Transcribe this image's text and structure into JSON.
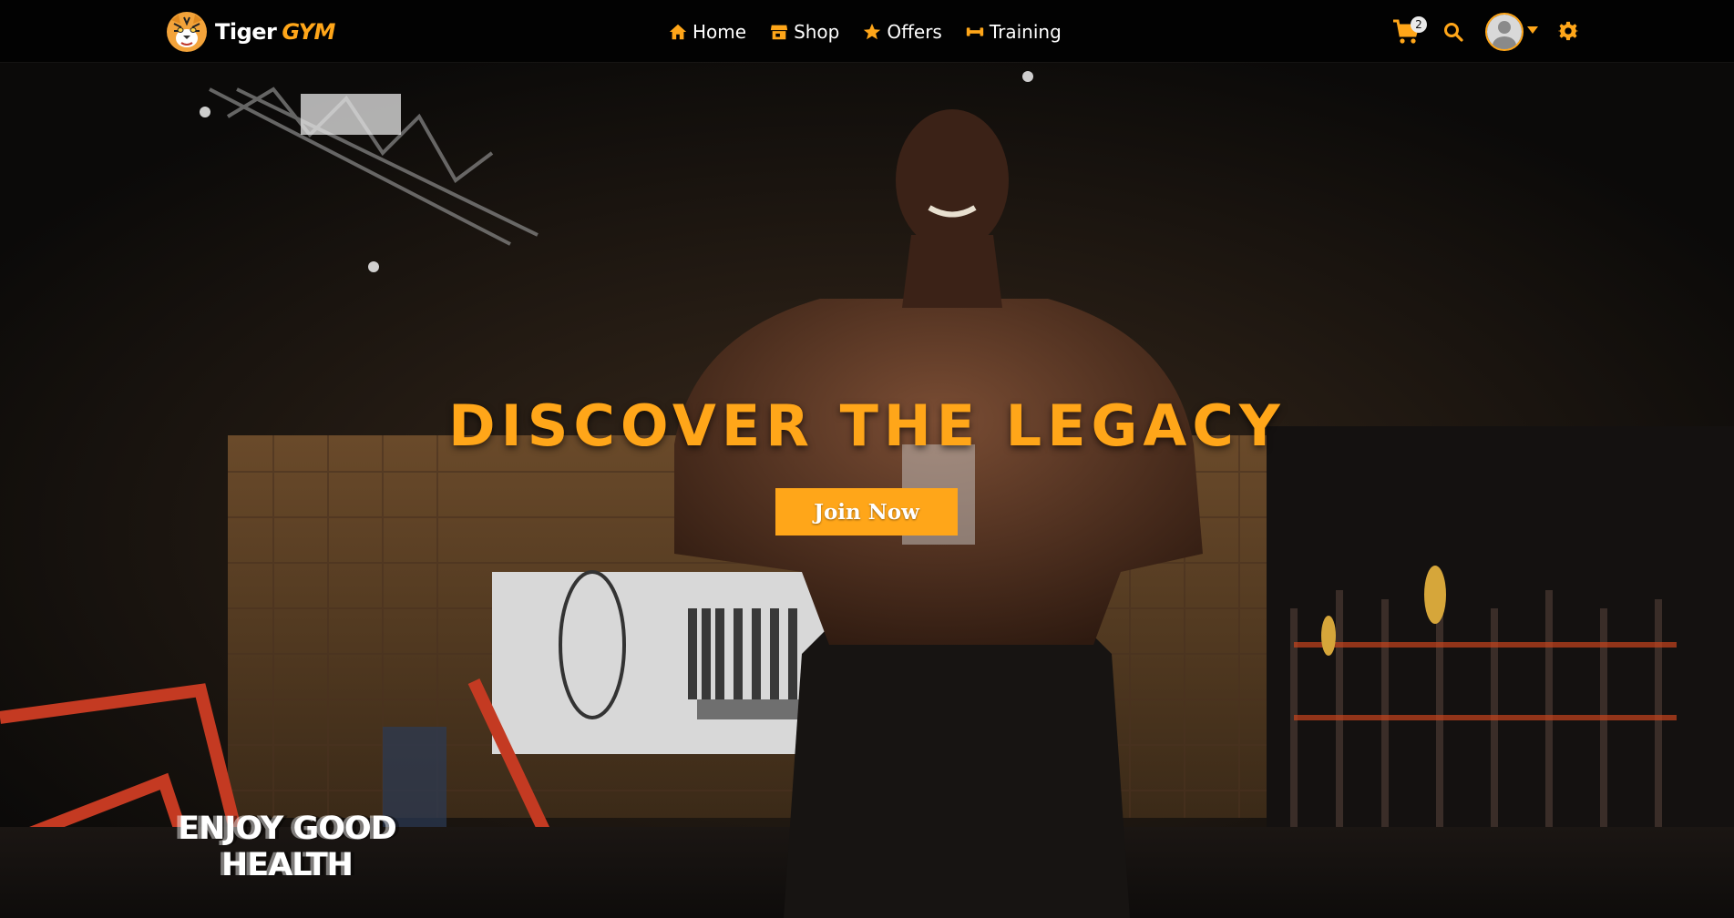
{
  "brand": {
    "name_white": "Tiger",
    "name_orange": "GYM",
    "logo_icon": "tiger-head-icon"
  },
  "nav": {
    "items": [
      {
        "label": "Home",
        "icon": "home-icon"
      },
      {
        "label": "Shop",
        "icon": "store-icon"
      },
      {
        "label": "Offers",
        "icon": "star-icon"
      },
      {
        "label": "Training",
        "icon": "dumbbell-icon"
      }
    ]
  },
  "header_actions": {
    "cart_count": "2",
    "icons": [
      "cart-icon",
      "search-icon",
      "avatar",
      "caret-down-icon",
      "gear-icon"
    ]
  },
  "hero": {
    "title": "DISCOVER THE LEGACY",
    "cta_label": "Join Now",
    "tagline_line1": "ENJOY GOOD",
    "tagline_line2": "HEALTH"
  },
  "colors": {
    "accent": "#ffa619",
    "navbar_bg": "#020202",
    "text": "#ffffff"
  }
}
